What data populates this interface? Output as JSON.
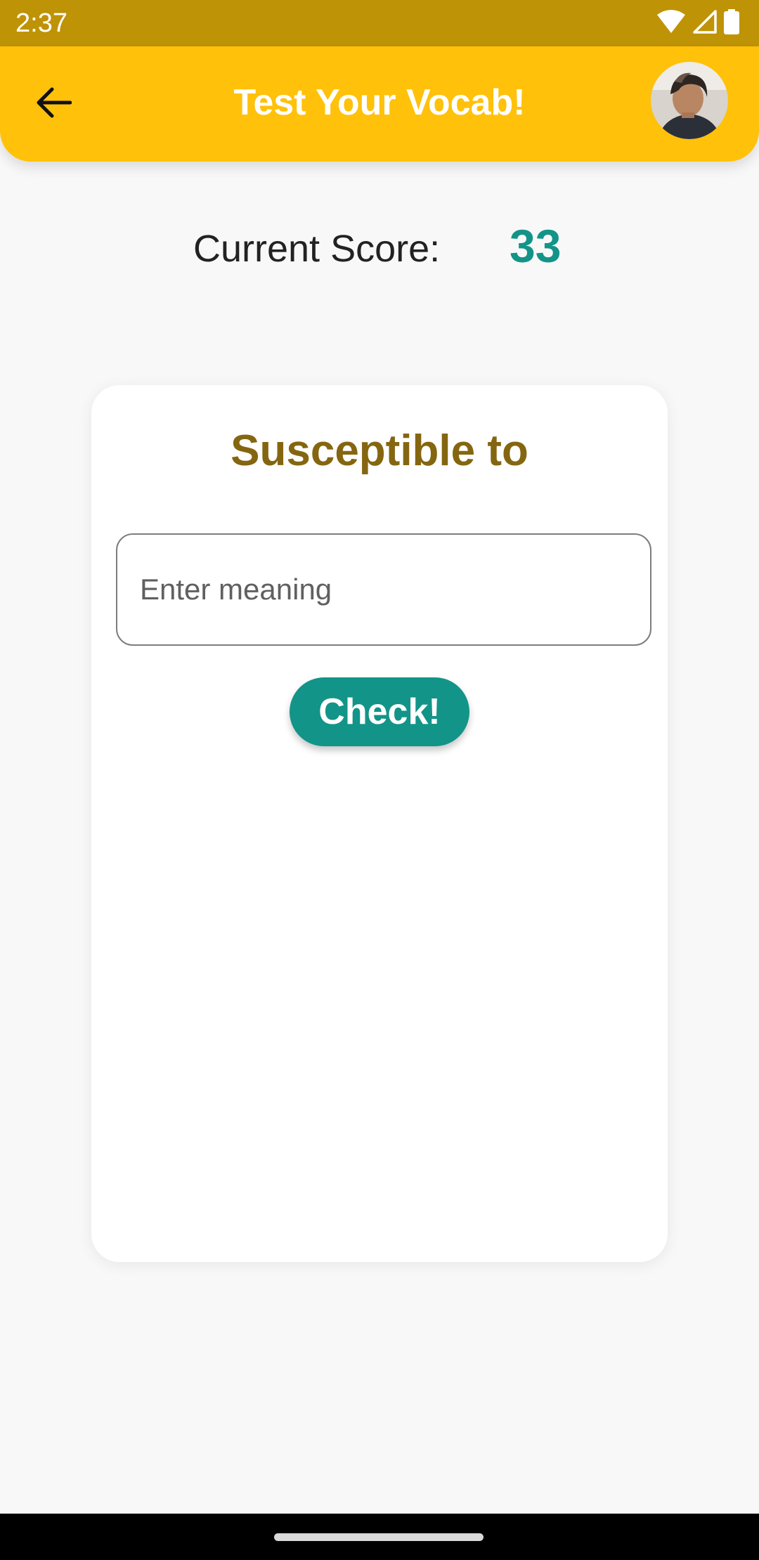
{
  "status_bar": {
    "time": "2:37",
    "icons": [
      "wifi-icon",
      "signal-icon",
      "battery-icon"
    ]
  },
  "app_bar": {
    "title": "Test Your Vocab!",
    "back_icon": "arrow-left-icon",
    "avatar": "profile-avatar"
  },
  "score": {
    "label": "Current Score:",
    "value": "33"
  },
  "quiz": {
    "word": "Susceptible to",
    "input_placeholder": "Enter meaning",
    "input_value": "",
    "check_label": "Check!"
  },
  "colors": {
    "status_bar": "#bf9306",
    "app_bar": "#ffc10a",
    "accent": "#139488",
    "word": "#856610",
    "background": "#f8f8f8"
  }
}
